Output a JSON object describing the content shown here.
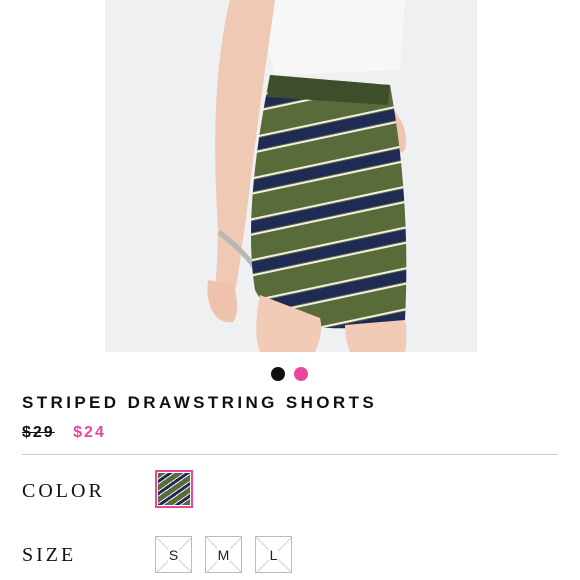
{
  "product": {
    "title": "STRIPED DRAWSTRING SHORTS",
    "original_price": "$29",
    "sale_price": "$24",
    "image": "striped-shorts-photo",
    "carousel": {
      "count": 2,
      "active_index": 1
    }
  },
  "options": {
    "color_label": "COLOR",
    "size_label": "SIZE",
    "color_swatch": "green-navy-stripe",
    "sizes": [
      "S",
      "M",
      "L"
    ]
  },
  "colors": {
    "accent": "#e8479f",
    "olive": "#5a6b3a",
    "navy": "#1f2a55",
    "text": "#111111"
  }
}
